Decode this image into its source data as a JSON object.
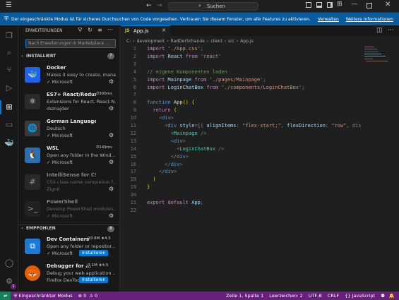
{
  "titlebar": {
    "search_placeholder": "Suchen"
  },
  "banner": {
    "message": "Der eingeschränkte Modus ist für sicheres Durchsuchen von Code vorgesehen. Vertrauen Sie diesem Fenster, um alle Features zu aktivieren.",
    "manage_link": "Verwalten",
    "more_link": "Weitere Informationen"
  },
  "sidebar": {
    "title": "ERWEITERUNGEN",
    "search_placeholder": "Nach Erweiterungen in Marketplace ...",
    "installed_header": "INSTALLIERT",
    "installed_count": "7",
    "recommended_header": "EMPFOHLEN",
    "recommended_count": "8",
    "installed": [
      {
        "name": "Docker",
        "desc": "Makes it easy to create, mana...",
        "publisher": "Microsoft",
        "stat": "",
        "icon": "whale-icon",
        "color": "#1d63ed"
      },
      {
        "name": "ES7+ React/Redux/...",
        "desc": "Extensions for React, React-N...",
        "publisher": "dsznajder",
        "stat": "300ms",
        "icon": "react-icon",
        "color": "#2a2a2a"
      },
      {
        "name": "German Language Pack for...",
        "desc": "Deutsch",
        "publisher": "Microsoft",
        "stat": "",
        "icon": "globe-icon",
        "color": "#3a3a3a"
      },
      {
        "name": "WSL",
        "desc": "Open any folder in the Wind...",
        "publisher": "Microsoft",
        "stat": "149ms",
        "icon": "penguin-icon",
        "color": "#2a6fb0"
      },
      {
        "name": "IntelliSense for CSS class n...",
        "desc": "CSS class name completion f...",
        "publisher": "Zignd",
        "stat": "",
        "icon": "css-icon",
        "color": "#3a3a3a"
      },
      {
        "name": "PowerShell",
        "desc": "Develop PowerShell modules,...",
        "publisher": "Microsoft",
        "stat": "",
        "icon": "terminal-icon",
        "color": "#2b2b2b"
      }
    ],
    "recommended": [
      {
        "name": "Dev Containers",
        "desc": "Open any folder or repositor...",
        "publisher": "Microsoft",
        "downloads": "19.8M",
        "rating": "4.5",
        "install": "Installieren",
        "icon": "container-icon",
        "color": "#1c7ad4"
      },
      {
        "name": "Debugger for ...",
        "desc": "Debug your web application ...",
        "publisher": "Firefox DevTools",
        "downloads": "3.1M",
        "rating": "4.5",
        "install": "Installieren",
        "icon": "firefox-icon",
        "color": "#e66000"
      }
    ]
  },
  "editor": {
    "tab": "App.js",
    "breadcrumb": [
      "C:",
      "development",
      "RadDerSchande",
      "client",
      "src",
      "App.js"
    ],
    "lines": [
      {
        "n": "1",
        "tokens": [
          [
            "k",
            "import "
          ],
          [
            "s",
            "'./App.css'"
          ],
          [
            "p",
            ";"
          ]
        ]
      },
      {
        "n": "2",
        "tokens": [
          [
            "k",
            "import "
          ],
          [
            "v",
            "React "
          ],
          [
            "k",
            "from "
          ],
          [
            "s",
            "'react'"
          ]
        ]
      },
      {
        "n": "3",
        "tokens": []
      },
      {
        "n": "4",
        "tokens": [
          [
            "c",
            "// eigene Komponenten laden"
          ]
        ]
      },
      {
        "n": "5",
        "tokens": [
          [
            "k",
            "import "
          ],
          [
            "v",
            "Mainpage "
          ],
          [
            "k",
            "from "
          ],
          [
            "s",
            "'./pages/Mainpage'"
          ],
          [
            "p",
            ";"
          ]
        ]
      },
      {
        "n": "6",
        "tokens": [
          [
            "k",
            "import "
          ],
          [
            "v",
            "LoginChatBox "
          ],
          [
            "k",
            "from "
          ],
          [
            "s",
            "'./components/LoginChatBox'"
          ],
          [
            "p",
            ";"
          ]
        ]
      },
      {
        "n": "7",
        "tokens": []
      },
      {
        "n": "8",
        "tokens": [
          [
            "t",
            "function "
          ],
          [
            "f",
            "App"
          ],
          [
            "y",
            "() {"
          ]
        ]
      },
      {
        "n": "9",
        "tokens": [
          [
            "p",
            "  "
          ],
          [
            "k",
            "return "
          ],
          [
            "y",
            "("
          ]
        ]
      },
      {
        "n": "10",
        "tokens": [
          [
            "p",
            "    <"
          ],
          [
            "t",
            "div"
          ],
          [
            "p",
            ">"
          ]
        ]
      },
      {
        "n": "11",
        "tokens": [
          [
            "p",
            "      <"
          ],
          [
            "t",
            "div "
          ],
          [
            "v",
            "style"
          ],
          [
            "p",
            "={{ "
          ],
          [
            "v",
            "alignItems"
          ],
          [
            "p",
            ": "
          ],
          [
            "s",
            "\"flex-start;\""
          ],
          [
            "p",
            ", "
          ],
          [
            "v",
            "flexDirection"
          ],
          [
            "p",
            ": "
          ],
          [
            "s",
            "\"row\""
          ],
          [
            "p",
            ", dis"
          ]
        ]
      },
      {
        "n": "12",
        "tokens": [
          [
            "p",
            "        <"
          ],
          [
            "g",
            "Mainpage "
          ],
          [
            "p",
            "/>"
          ]
        ]
      },
      {
        "n": "13",
        "tokens": [
          [
            "p",
            "        <"
          ],
          [
            "t",
            "div"
          ],
          [
            "p",
            ">"
          ]
        ]
      },
      {
        "n": "14",
        "tokens": [
          [
            "p",
            "          <"
          ],
          [
            "g",
            "LoginChatBox "
          ],
          [
            "p",
            "/>"
          ]
        ]
      },
      {
        "n": "15",
        "tokens": [
          [
            "p",
            "        </"
          ],
          [
            "t",
            "div"
          ],
          [
            "p",
            ">"
          ]
        ]
      },
      {
        "n": "16",
        "tokens": [
          [
            "p",
            "      </"
          ],
          [
            "t",
            "div"
          ],
          [
            "p",
            ">"
          ]
        ]
      },
      {
        "n": "17",
        "tokens": [
          [
            "p",
            "    </"
          ],
          [
            "t",
            "div"
          ],
          [
            "p",
            ">"
          ]
        ]
      },
      {
        "n": "18",
        "tokens": [
          [
            "y",
            "  )"
          ]
        ]
      },
      {
        "n": "19",
        "tokens": [
          [
            "y",
            "}"
          ]
        ]
      },
      {
        "n": "20",
        "tokens": []
      },
      {
        "n": "21",
        "tokens": [
          [
            "k",
            "export default "
          ],
          [
            "v",
            "App"
          ],
          [
            "p",
            ";"
          ]
        ]
      },
      {
        "n": "22",
        "tokens": []
      }
    ]
  },
  "statusbar": {
    "restricted": "Eingeschränkter Modus",
    "errors": "0",
    "warnings": "0",
    "position": "Zeile 1, Spalte 1",
    "indent": "Leerzeichen: 2",
    "encoding": "UTF-8",
    "eol": "CRLF",
    "language": "JavaScript"
  },
  "activity": {
    "badge": "1"
  },
  "colors": {
    "accent": "#0078d4",
    "statusbar": "#68217a",
    "banner": "#0a5c9e"
  }
}
